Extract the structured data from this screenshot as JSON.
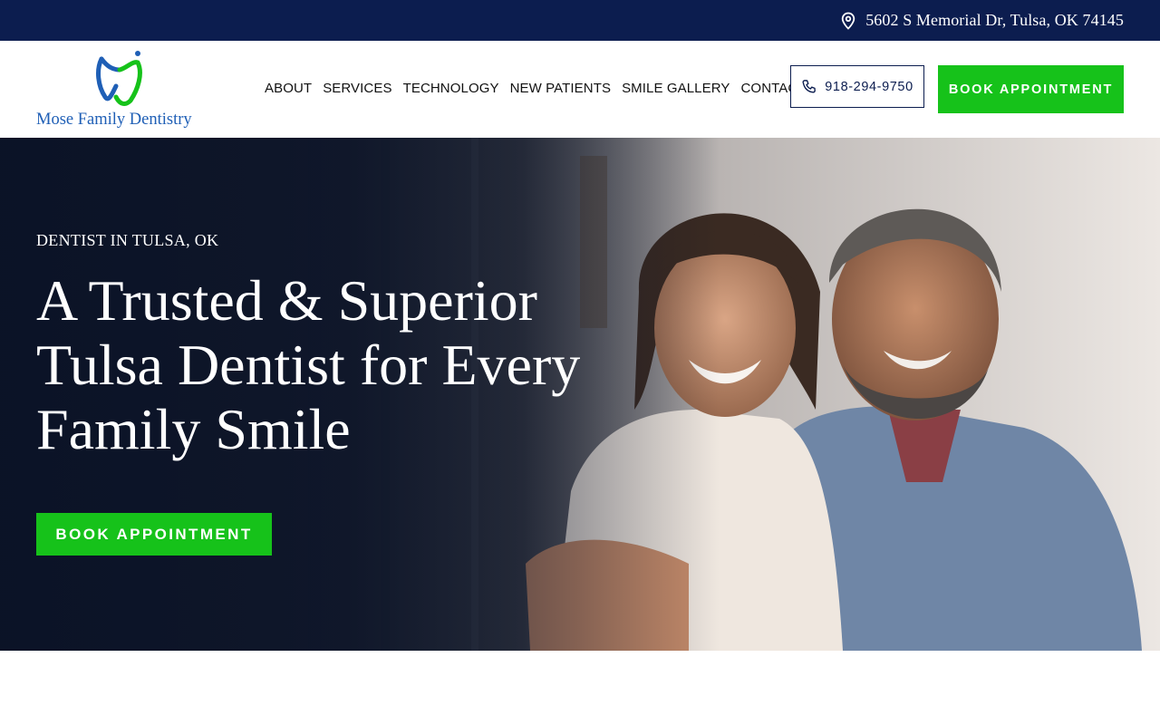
{
  "topbar": {
    "address": "5602 S Memorial Dr, Tulsa, OK 74145",
    "icon": "location-pin-icon"
  },
  "header": {
    "logo_text": "Mose Family Dentistry",
    "nav": [
      "ABOUT",
      "SERVICES",
      "TECHNOLOGY",
      "NEW PATIENTS",
      "SMILE GALLERY",
      "CONTACT"
    ],
    "phone": "918-294-9750",
    "phone_icon": "phone-icon",
    "book_label": "BOOK APPOINTMENT"
  },
  "hero": {
    "eyebrow": "DENTIST IN TULSA, OK",
    "headline": "A Trusted & Superior Tulsa Dentist for Every Family Smile",
    "cta_label": "BOOK APPOINTMENT"
  },
  "colors": {
    "navy": "#0c1d4f",
    "green": "#16c21a",
    "logo_blue": "#1f5fb6"
  }
}
